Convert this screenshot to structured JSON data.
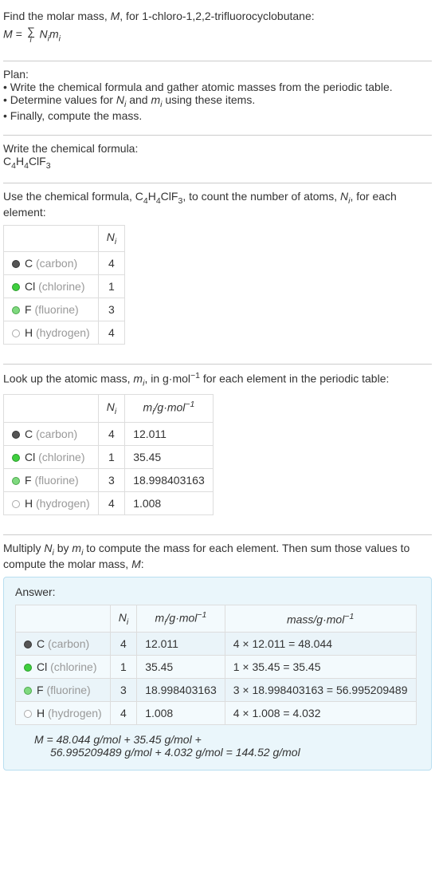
{
  "intro": {
    "line1_prefix": "Find the molar mass, ",
    "line1_mid": ", for 1-chloro-1,2,2-trifluorocyclobutane:",
    "M": "M",
    "eq": " = ",
    "sigma": "∑",
    "i": "i",
    "Ni": "N",
    "Ni_sub": "i",
    "mi": "m",
    "mi_sub": "i"
  },
  "plan": {
    "title": "Plan:",
    "b1": "• Write the chemical formula and gather atomic masses from the periodic table.",
    "b2_prefix": "• Determine values for ",
    "b2_mid": " and ",
    "b2_suffix": " using these items.",
    "b3": "• Finally, compute the mass."
  },
  "write_formula": {
    "title": "Write the chemical formula:",
    "formula_C": "C",
    "formula_C_n": "4",
    "formula_H": "H",
    "formula_H_n": "4",
    "formula_Cl": "Cl",
    "formula_F": "F",
    "formula_F_n": "3"
  },
  "count_atoms": {
    "prefix": "Use the chemical formula, ",
    "mid": ", to count the number of atoms, ",
    "suffix": ", for each element:"
  },
  "table1": {
    "col_Ni": "N",
    "col_Ni_sub": "i",
    "rows": [
      {
        "sym": "C",
        "name": "(carbon)",
        "n": "4",
        "dot": "dot-c"
      },
      {
        "sym": "Cl",
        "name": "(chlorine)",
        "n": "1",
        "dot": "dot-cl"
      },
      {
        "sym": "F",
        "name": "(fluorine)",
        "n": "3",
        "dot": "dot-f"
      },
      {
        "sym": "H",
        "name": "(hydrogen)",
        "n": "4",
        "dot": "dot-h"
      }
    ]
  },
  "lookup": {
    "prefix": "Look up the atomic mass, ",
    "mid": ", in g·mol",
    "exp": "−1",
    "suffix": " for each element in the periodic table:"
  },
  "table2": {
    "col_mi": "m",
    "col_mi_sub": "i",
    "unit_prefix": "/g·mol",
    "unit_exp": "−1",
    "rows": [
      {
        "sym": "C",
        "name": "(carbon)",
        "n": "4",
        "m": "12.011",
        "dot": "dot-c"
      },
      {
        "sym": "Cl",
        "name": "(chlorine)",
        "n": "1",
        "m": "35.45",
        "dot": "dot-cl"
      },
      {
        "sym": "F",
        "name": "(fluorine)",
        "n": "3",
        "m": "18.998403163",
        "dot": "dot-f"
      },
      {
        "sym": "H",
        "name": "(hydrogen)",
        "n": "4",
        "m": "1.008",
        "dot": "dot-h"
      }
    ]
  },
  "multiply": {
    "prefix": "Multiply ",
    "mid1": " by ",
    "mid2": " to compute the mass for each element. Then sum those values to compute the molar mass, ",
    "suffix": ":"
  },
  "answer": {
    "title": "Answer:",
    "mass_col_prefix": "mass/g·mol",
    "mass_col_exp": "−1",
    "rows": [
      {
        "sym": "C",
        "name": "(carbon)",
        "n": "4",
        "m": "12.011",
        "calc": "4 × 12.011 = 48.044",
        "dot": "dot-c"
      },
      {
        "sym": "Cl",
        "name": "(chlorine)",
        "n": "1",
        "m": "35.45",
        "calc": "1 × 35.45 = 35.45",
        "dot": "dot-cl"
      },
      {
        "sym": "F",
        "name": "(fluorine)",
        "n": "3",
        "m": "18.998403163",
        "calc": "3 × 18.998403163 = 56.995209489",
        "dot": "dot-f"
      },
      {
        "sym": "H",
        "name": "(hydrogen)",
        "n": "4",
        "m": "1.008",
        "calc": "4 × 1.008 = 4.032",
        "dot": "dot-h"
      }
    ],
    "final_line1": "M = 48.044 g/mol + 35.45 g/mol +",
    "final_line2": "56.995209489 g/mol + 4.032 g/mol = 144.52 g/mol"
  }
}
